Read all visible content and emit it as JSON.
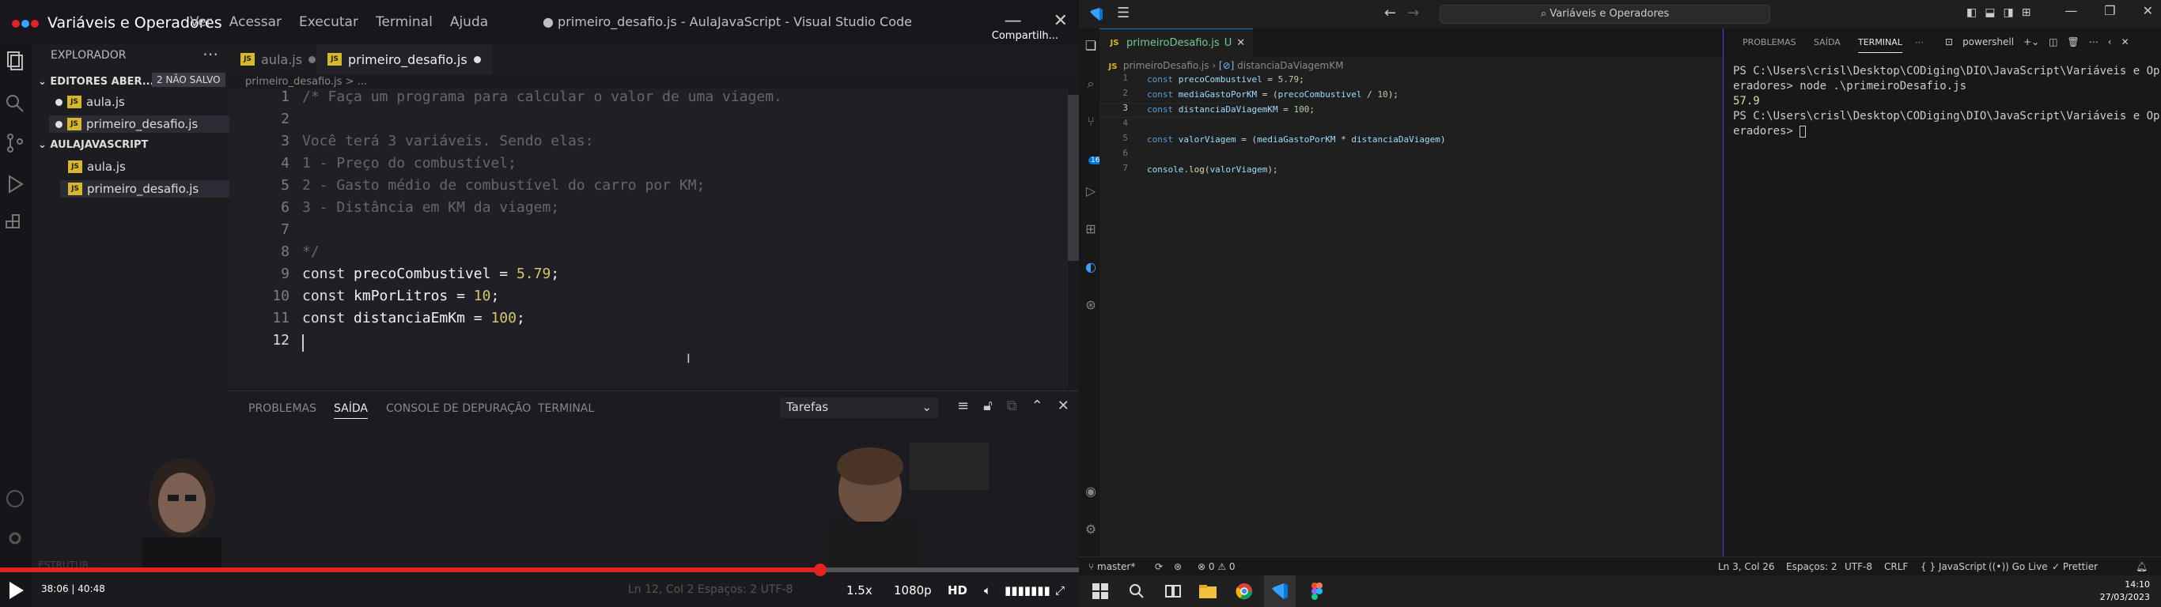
{
  "video": {
    "title": "Variáveis e Operadores",
    "menu": [
      "Ver",
      "Acessar",
      "Executar",
      "Terminal",
      "Ajuda"
    ],
    "window_title": "● primeiro_desafio.js - AulaJavaScript - Visual Studio Code",
    "share_label": "Compartilh...",
    "sidebar": {
      "header": "EXPLORADOR",
      "open_editors_label": "EDITORES ABER...",
      "unsaved_badge": "2 NÃO SALVO",
      "open_files": [
        "aula.js",
        "primeiro_desafio.js"
      ],
      "project_label": "AULAJAVASCRIPT",
      "project_files": [
        "aula.js",
        "primeiro_desafio.js"
      ],
      "outline_label": "ESTRUTUR..."
    },
    "tabs": [
      "aula.js",
      "primeiro_desafio.js"
    ],
    "breadcrumb": "primeiro_desafio.js > ...",
    "code_lines": [
      {
        "n": "1",
        "text": "/* Faça um programa para calcular o valor de uma viagem."
      },
      {
        "n": "2",
        "text": ""
      },
      {
        "n": "3",
        "text": "Você terá 3 variáveis. Sendo elas:"
      },
      {
        "n": "4",
        "text": "1 - Preço do combustível;"
      },
      {
        "n": "5",
        "text": "2 - Gasto médio de combustível do carro por KM;"
      },
      {
        "n": "6",
        "text": "3 - Distância em KM da viagem;"
      },
      {
        "n": "7",
        "text": ""
      },
      {
        "n": "8",
        "text": "*/"
      },
      {
        "n": "9",
        "kw": "const",
        "id": "precoCombustivel",
        "op": " = ",
        "num": "5.79",
        "end": ";"
      },
      {
        "n": "10",
        "kw": "const",
        "id": "kmPorLitros",
        "op": " = ",
        "num": "10",
        "end": ";"
      },
      {
        "n": "11",
        "kw": "const",
        "id": "distanciaEmKm",
        "op": " = ",
        "num": "100",
        "end": ";"
      },
      {
        "n": "12",
        "text": ""
      }
    ],
    "panel_tabs": [
      "PROBLEMAS",
      "SAÍDA",
      "CONSOLE DE DEPURAÇÃO",
      "TERMINAL"
    ],
    "panel_active_tab": "SAÍDA",
    "tasks_select": "Tarefas",
    "player": {
      "time": "38:06 | 40:48",
      "progress": 0.934,
      "speed": "1.5x",
      "quality": "1080p",
      "hd": "HD",
      "faded_status": "Ln 12, Col 2    Espaços: 2    UTF-8"
    }
  },
  "vscode": {
    "search_text": "Variáveis e Operadores",
    "tab_label": "primeiroDesafio.js",
    "tab_status": "U",
    "breadcrumb_file": "primeiroDesafio.js",
    "breadcrumb_symbol": "distanciaDaViagemKM",
    "code": [
      {
        "n": "1",
        "parts": [
          [
            "k-blue",
            "const "
          ],
          [
            "k-var",
            "precoCombustivel"
          ],
          [
            "k-op",
            " = "
          ],
          [
            "k-num",
            "5.79"
          ],
          [
            "k-op",
            ";"
          ]
        ]
      },
      {
        "n": "2",
        "parts": [
          [
            "k-blue",
            "const "
          ],
          [
            "k-var",
            "mediaGastoPorKM"
          ],
          [
            "k-op",
            " = ("
          ],
          [
            "k-var",
            "precoCombustivel"
          ],
          [
            "k-op",
            " / "
          ],
          [
            "k-num",
            "10"
          ],
          [
            "k-op",
            ");"
          ]
        ]
      },
      {
        "n": "3",
        "parts": [
          [
            "k-blue",
            "const "
          ],
          [
            "k-var",
            "distanciaDaViagemKM"
          ],
          [
            "k-op",
            " = "
          ],
          [
            "k-num",
            "100"
          ],
          [
            "k-op",
            ";"
          ]
        ]
      },
      {
        "n": "4",
        "parts": []
      },
      {
        "n": "5",
        "parts": [
          [
            "k-blue",
            "const "
          ],
          [
            "k-var",
            "valorViagem"
          ],
          [
            "k-op",
            " = ("
          ],
          [
            "k-var",
            "mediaGastoPorKM"
          ],
          [
            "k-op",
            " * "
          ],
          [
            "k-var",
            "distanciaDaViagem"
          ],
          [
            "k-op",
            ")"
          ]
        ]
      },
      {
        "n": "6",
        "parts": []
      },
      {
        "n": "7",
        "parts": [
          [
            "k-var",
            "console"
          ],
          [
            "k-op",
            "."
          ],
          [
            "k-fn",
            "log"
          ],
          [
            "k-op",
            "("
          ],
          [
            "k-var",
            "valorViagem"
          ],
          [
            "k-op",
            ");"
          ]
        ]
      }
    ],
    "panel_tabs": [
      "PROBLEMAS",
      "SAÍDA",
      "TERMINAL"
    ],
    "panel_active_tab": "TERMINAL",
    "shell_label": "powershell",
    "terminal_lines": [
      "PS C:\\Users\\crisl\\Desktop\\CODiging\\DIO\\JavaScript\\Variáveis e Op",
      "eradores> node .\\primeiroDesafio.js",
      "57.9",
      "PS C:\\Users\\crisl\\Desktop\\CODiging\\DIO\\JavaScript\\Variáveis e Op",
      "eradores> "
    ],
    "status": {
      "branch": "master*",
      "errors": "⊗ 0 ⚠ 0",
      "position": "Ln 3, Col 26",
      "spaces": "Espaços: 2",
      "encoding": "UTF-8",
      "eol": "CRLF",
      "language": "{ } JavaScript",
      "golive": "Go Live",
      "prettier": "✓ Prettier"
    },
    "activity_badge": "164",
    "clock": {
      "time": "14:10",
      "date": "27/03/2023"
    }
  },
  "colors": {
    "accent": "#0078d4",
    "youtube_red": "#e52222",
    "js_yellow": "#d7b82c"
  }
}
